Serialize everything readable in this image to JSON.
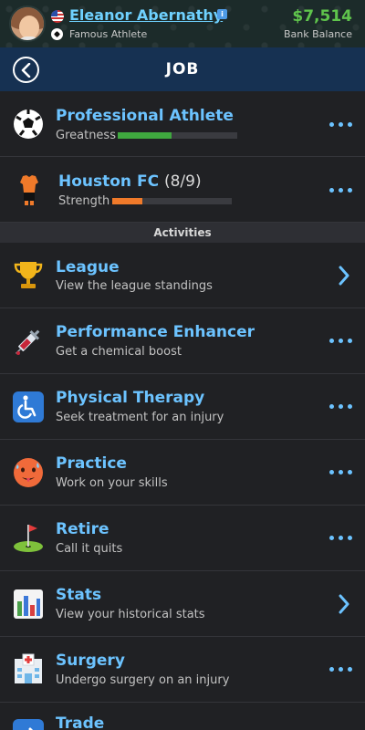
{
  "profile": {
    "name": "Eleanor Abernathy",
    "subtitle": "Famous Athlete",
    "balance": "$7,514",
    "balance_label": "Bank Balance"
  },
  "nav": {
    "title": "JOB"
  },
  "job_rows": [
    {
      "title": "Professional Athlete",
      "stat_label": "Greatness",
      "stat_value": 0.45,
      "stat_color": "#3fa83f"
    },
    {
      "title": "Houston FC",
      "count": "(8/9)",
      "stat_label": "Strength",
      "stat_value": 0.25,
      "stat_color": "#f07a2a"
    }
  ],
  "section": {
    "title": "Activities"
  },
  "activities": [
    {
      "title": "League",
      "desc": "View the league standings",
      "action": "chevron",
      "icon": "trophy-icon"
    },
    {
      "title": "Performance Enhancer",
      "desc": "Get a chemical boost",
      "action": "dots",
      "icon": "syringe-icon"
    },
    {
      "title": "Physical Therapy",
      "desc": "Seek treatment for an injury",
      "action": "dots",
      "icon": "wheelchair-icon"
    },
    {
      "title": "Practice",
      "desc": "Work on your skills",
      "action": "dots",
      "icon": "sweating-face-icon"
    },
    {
      "title": "Retire",
      "desc": "Call it quits",
      "action": "dots",
      "icon": "golf-flag-icon"
    },
    {
      "title": "Stats",
      "desc": "View your historical stats",
      "action": "chevron",
      "icon": "bar-chart-icon"
    },
    {
      "title": "Surgery",
      "desc": "Undergo surgery on an injury",
      "action": "dots",
      "icon": "hospital-icon"
    },
    {
      "title": "Trade",
      "desc": "",
      "action": "dots",
      "icon": "trade-arrow-icon"
    }
  ],
  "colors": {
    "accent": "#6cc3ff",
    "balance": "#5fc44c",
    "navbar": "#163152"
  }
}
